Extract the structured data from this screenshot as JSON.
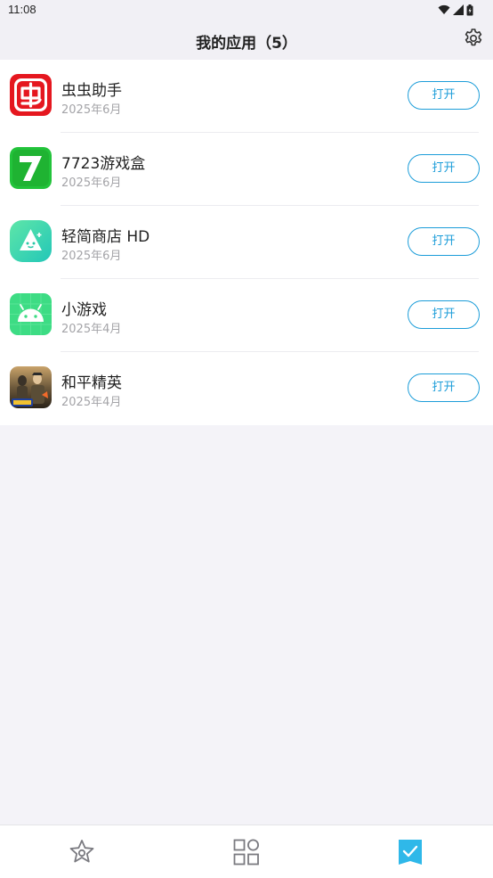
{
  "status_bar": {
    "time": "11:08",
    "icons": [
      "wifi-icon",
      "signal-icon",
      "battery-icon"
    ]
  },
  "header": {
    "title": "我的应用（5）",
    "settings_icon": "gear-icon"
  },
  "apps": [
    {
      "name": "虫虫助手",
      "date": "2025年6月",
      "button": "打开",
      "icon": "chongchong-app-icon"
    },
    {
      "name": "7723游戏盒",
      "date": "2025年6月",
      "button": "打开",
      "icon": "7723-app-icon"
    },
    {
      "name": "轻简商店 HD",
      "date": "2025年6月",
      "button": "打开",
      "icon": "qingjian-store-app-icon"
    },
    {
      "name": "小游戏",
      "date": "2025年4月",
      "button": "打开",
      "icon": "android-app-icon"
    },
    {
      "name": "和平精英",
      "date": "2025年4月",
      "button": "打开",
      "icon": "peace-elite-app-icon"
    }
  ],
  "bottom_nav": {
    "items": [
      {
        "icon": "star-icon",
        "active": false
      },
      {
        "icon": "grid-icon",
        "active": false
      },
      {
        "icon": "check-bookmark-icon",
        "active": true
      }
    ]
  },
  "colors": {
    "accent": "#1c9dd9",
    "active_nav": "#2fb8e9",
    "inactive_nav": "#7a7a80",
    "background": "#f4f3f8"
  }
}
